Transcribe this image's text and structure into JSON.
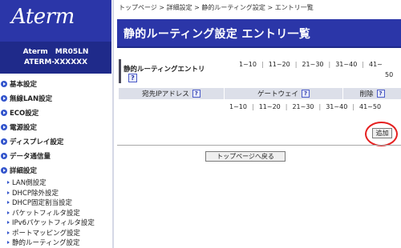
{
  "sidebar": {
    "logo": "Aterm",
    "model_line1": "Aterm　MR05LN",
    "model_line2": "ATERM-XXXXXX",
    "items": [
      {
        "label": "基本設定"
      },
      {
        "label": "無線LAN設定"
      },
      {
        "label": "ECO設定"
      },
      {
        "label": "電源設定"
      },
      {
        "label": "ディスプレイ設定"
      },
      {
        "label": "データ通信量"
      },
      {
        "label": "詳細設定"
      }
    ],
    "sub_items": [
      {
        "label": "LAN側設定"
      },
      {
        "label": "DHCP除外設定"
      },
      {
        "label": "DHCP固定割当設定"
      },
      {
        "label": "パケットフィルタ設定"
      },
      {
        "label": "IPv6パケットフィルタ設定"
      },
      {
        "label": "ポートマッピング設定"
      },
      {
        "label": "静的ルーティング設定"
      }
    ],
    "accent": "#2b36a8"
  },
  "breadcrumb": "トップページ > 詳細設定 > 静的ルーティング設定 > エントリ一覧",
  "page_title": "静的ルーティング設定 エントリ一覧",
  "entry_section": {
    "label": "静的ルーティングエントリ",
    "help": "?"
  },
  "ranges_top": [
    "1~10",
    "11~20",
    "21~30",
    "31~40",
    "41~"
  ],
  "range_tail": "50",
  "table": {
    "columns": [
      {
        "label": "宛先IPアドレス",
        "help": "?"
      },
      {
        "label": "ゲートウェイ",
        "help": "?"
      },
      {
        "label": "削除",
        "help": "?"
      }
    ]
  },
  "ranges_bottom": [
    "1~10",
    "11~20",
    "21~30",
    "31~40",
    "41~50"
  ],
  "buttons": {
    "add": "追加",
    "top_page": "トップページへ戻る"
  },
  "highlight_color": "#e52020"
}
